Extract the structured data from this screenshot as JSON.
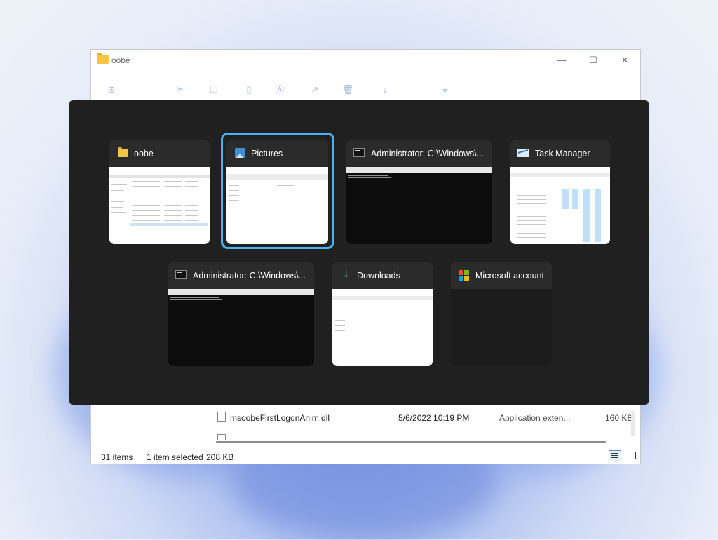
{
  "explorer": {
    "title": "oobe",
    "window_controls": {
      "minimize": "—",
      "maximize": "☐",
      "close": "✕"
    },
    "toolbar_icons": [
      "new-icon",
      "cut-icon",
      "copy-icon",
      "paste-icon",
      "rename-icon",
      "share-icon",
      "delete-icon",
      "sort-icon",
      "view-icon"
    ],
    "file_row": {
      "name": "msoobeFirstLogonAnim.dll",
      "date": "5/6/2022 10:19 PM",
      "type": "Application exten...",
      "size": "160 KB"
    },
    "status": {
      "items": "31 items",
      "selected": "1 item selected",
      "size": "208 KB"
    }
  },
  "switcher": {
    "windows": [
      {
        "title": "oobe",
        "icon": "folder-icon",
        "preview": "explorer",
        "selected": false
      },
      {
        "title": "Pictures",
        "icon": "pictures-icon",
        "preview": "explorer-empty",
        "selected": true
      },
      {
        "title": "Administrator: C:\\Windows\\...",
        "icon": "command-prompt-icon",
        "preview": "terminal",
        "selected": false
      },
      {
        "title": "Task Manager",
        "icon": "task-manager-icon",
        "preview": "taskmgr",
        "selected": false
      },
      {
        "title": "Administrator: C:\\Windows\\...",
        "icon": "command-prompt-icon",
        "preview": "terminal",
        "selected": false
      },
      {
        "title": "Downloads",
        "icon": "download-icon",
        "preview": "explorer-empty",
        "selected": false
      },
      {
        "title": "Microsoft account",
        "icon": "microsoft-logo-icon",
        "preview": "blank",
        "selected": false
      }
    ]
  },
  "colors": {
    "switcher_bg": "#202020",
    "card_header": "#2b2b2b",
    "selection_ring": "#4ab1f0",
    "microsoft_logo": [
      "#f25022",
      "#7fba00",
      "#00a4ef",
      "#ffb900"
    ]
  }
}
